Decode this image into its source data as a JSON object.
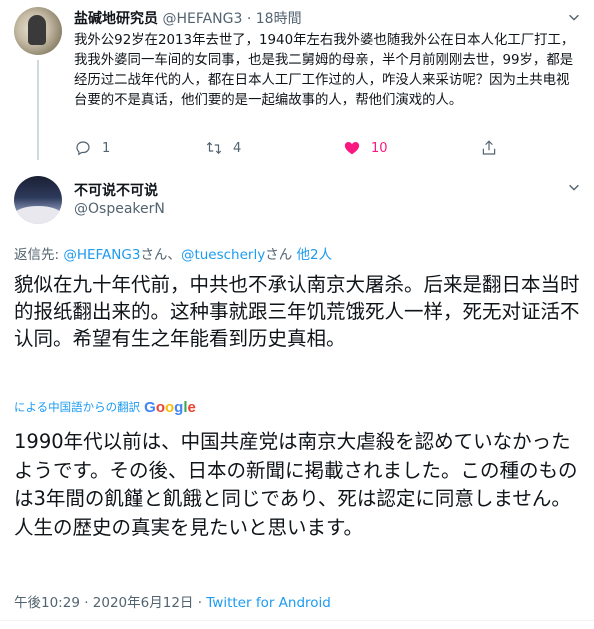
{
  "parent_tweet": {
    "display_name": "盐碱地研究员",
    "handle": "@HEFANG3",
    "separator": "·",
    "time": "18時間",
    "text": "我外公92岁在2013年去世了，1940年左右我外婆也随我外公在日本人化工厂打工，我我外婆同一车间的女同事，也是我二舅姆的母亲，半个月前刚刚去世，99岁，都是经历过二战年代的人，都在日本人工厂工作过的人，咋没人来采访呢？因为土共电视台要的不是真话，他们要的是一起编故事的人，帮他们演戏的人。",
    "actions": {
      "reply_count": "1",
      "retweet_count": "4",
      "like_count": "10",
      "liked": true,
      "icons": [
        "reply-icon",
        "retweet-icon",
        "heart-icon",
        "share-icon"
      ],
      "like_color": "#f91880"
    }
  },
  "main_tweet": {
    "display_name": "不可说不可说",
    "handle": "@OspeakerN",
    "reply_label": "返信先: ",
    "reply_user_1": "@HEFANG3",
    "reply_sep_1": "さん、",
    "reply_user_2": "@tuescherly",
    "reply_sep_2": "さん ",
    "reply_others": "他2人",
    "text": "貌似在九十年代前，中共也不承认南京大屠杀。后来是翻日本当时的报纸翻出来的。这种事就跟三年饥荒饿死人一样，死无对证活不认同。希望有生之年能看到历史真相。",
    "translation_label": "による中国語からの翻訳",
    "translation_provider": "Google",
    "translated_text": "1990年代以前は、中国共産党は南京大虐殺を認めていなかったようです。その後、日本の新聞に掲載されました。この種のものは3年間の飢饉と飢餓と同じであり、死は認定に同意しません。人生の歴史の真実を見たいと思います。",
    "timestamp": "午後10:29 · 2020年6月12日 · ",
    "source": "Twitter for Android"
  },
  "colors": {
    "link": "#1d9bf0",
    "secondary_text": "#536471",
    "primary_text": "#0f1419"
  }
}
